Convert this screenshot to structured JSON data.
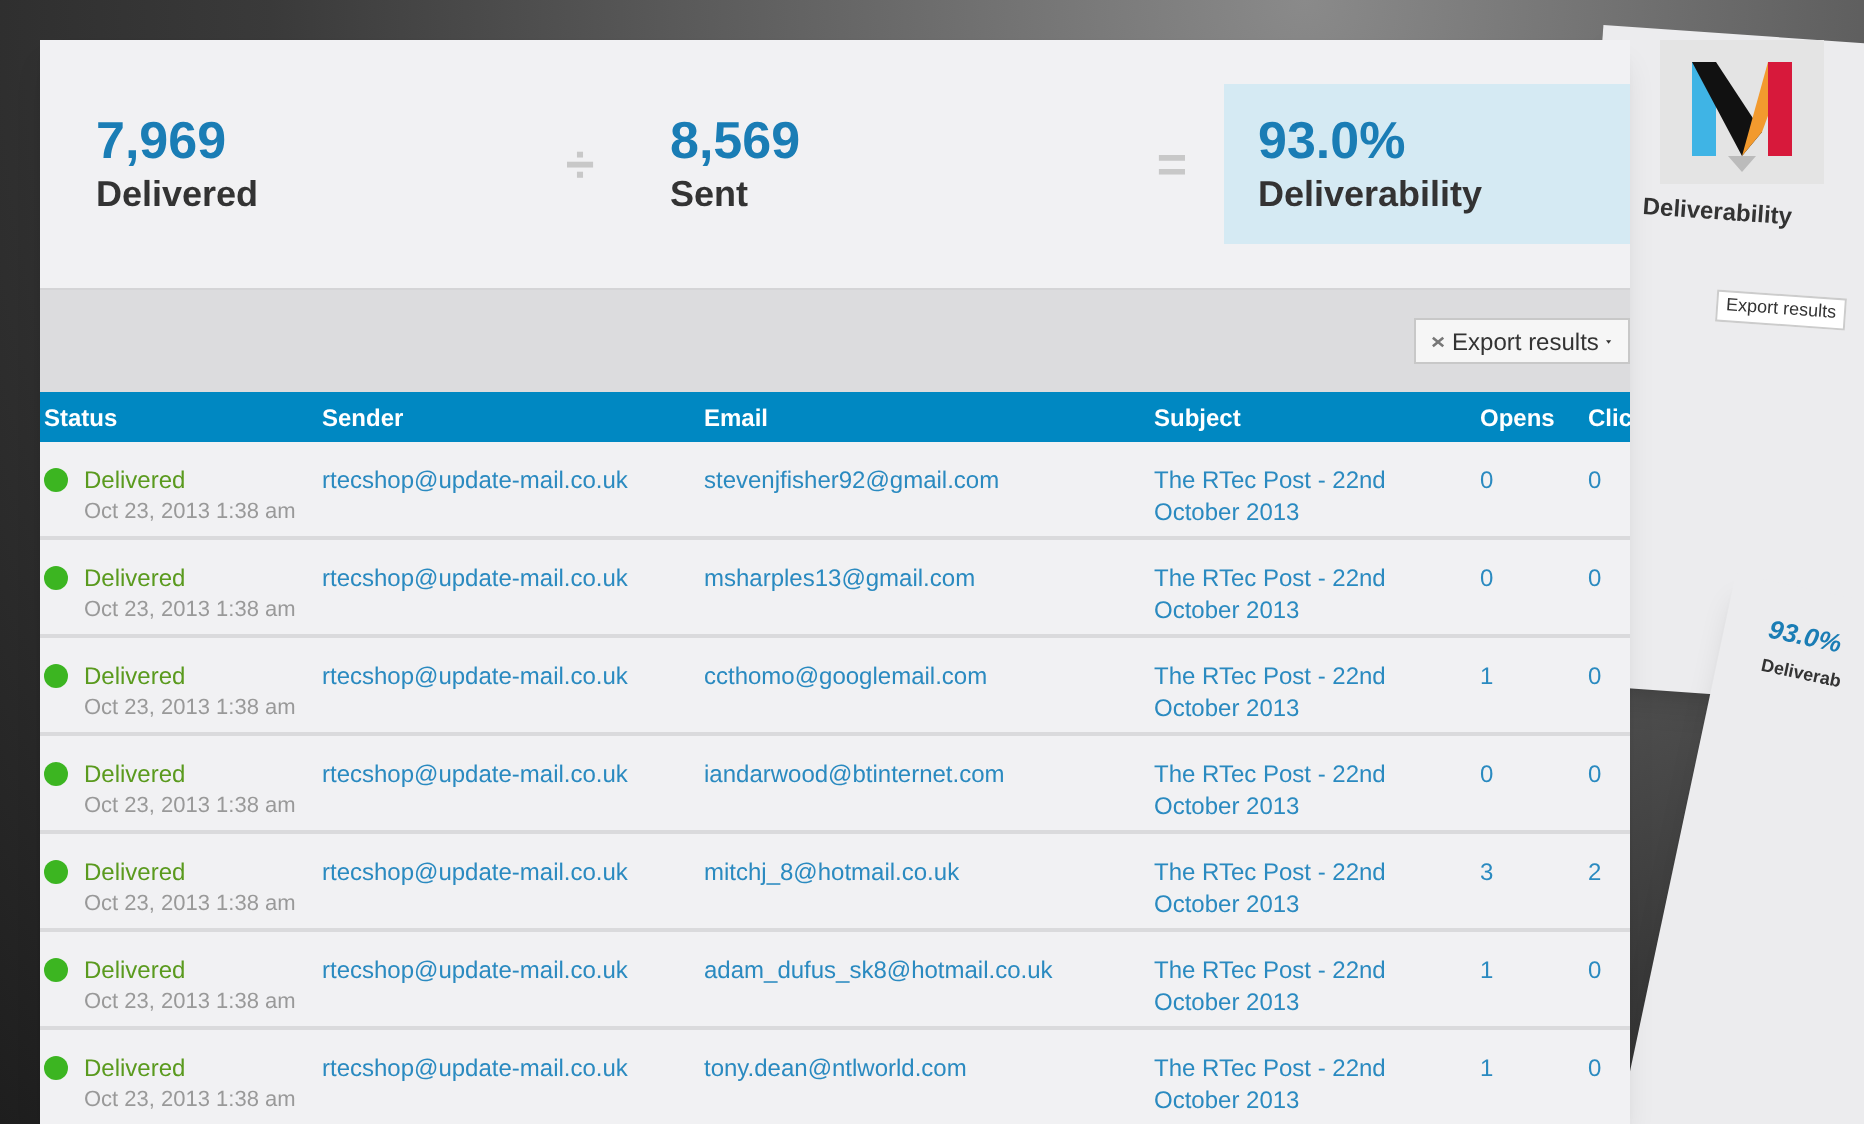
{
  "stats": [
    {
      "kind": "operand",
      "value": "7,969",
      "label": "Delivered"
    },
    {
      "kind": "operand",
      "operator": "÷",
      "value": "8,569",
      "label": "Sent"
    },
    {
      "kind": "result",
      "operator": "=",
      "value": "93.0%",
      "label": "Deliverability"
    }
  ],
  "toolbar": {
    "export_button": "Export results"
  },
  "table": {
    "columns": [
      "Status",
      "Sender",
      "Email",
      "Subject",
      "Opens",
      "Clic"
    ],
    "rows": [
      {
        "status": "Delivered",
        "date": "Oct 23, 2013 1:38 am",
        "color": "#3cb521",
        "sender": "rtecshop@update-mail.co.uk",
        "email": "stevenjfisher92@gmail.com",
        "subject": "The RTec Post - 22nd October 2013",
        "opens": "0",
        "clicks": "0"
      },
      {
        "status": "Delivered",
        "date": "Oct 23, 2013 1:38 am",
        "color": "#3cb521",
        "sender": "rtecshop@update-mail.co.uk",
        "email": "msharples13@gmail.com",
        "subject": "The RTec Post - 22nd October 2013",
        "opens": "0",
        "clicks": "0"
      },
      {
        "status": "Delivered",
        "date": "Oct 23, 2013 1:38 am",
        "color": "#3cb521",
        "sender": "rtecshop@update-mail.co.uk",
        "email": "ccthomo@googlemail.com",
        "subject": "The RTec Post - 22nd October 2013",
        "opens": "1",
        "clicks": "0"
      },
      {
        "status": "Delivered",
        "date": "Oct 23, 2013 1:38 am",
        "color": "#3cb521",
        "sender": "rtecshop@update-mail.co.uk",
        "email": "iandarwood@btinternet.com",
        "subject": "The RTec Post - 22nd October 2013",
        "opens": "0",
        "clicks": "0"
      },
      {
        "status": "Delivered",
        "date": "Oct 23, 2013 1:38 am",
        "color": "#3cb521",
        "sender": "rtecshop@update-mail.co.uk",
        "email": "mitchj_8@hotmail.co.uk",
        "subject": "The RTec Post - 22nd October 2013",
        "opens": "3",
        "clicks": "2"
      },
      {
        "status": "Delivered",
        "date": "Oct 23, 2013 1:38 am",
        "color": "#3cb521",
        "sender": "rtecshop@update-mail.co.uk",
        "email": "adam_dufus_sk8@hotmail.co.uk",
        "subject": "The RTec Post - 22nd October 2013",
        "opens": "1",
        "clicks": "0"
      },
      {
        "status": "Delivered",
        "date": "Oct 23, 2013 1:38 am",
        "color": "#3cb521",
        "sender": "rtecshop@update-mail.co.uk",
        "email": "tony.dean@ntlworld.com",
        "subject": "The RTec Post - 22nd October 2013",
        "opens": "1",
        "clicks": "0"
      }
    ]
  },
  "background_panels": [
    {
      "texts": [
        "Deliverability",
        "Export results"
      ]
    },
    {
      "texts": [
        "93.0%",
        "Deliverab"
      ]
    }
  ]
}
